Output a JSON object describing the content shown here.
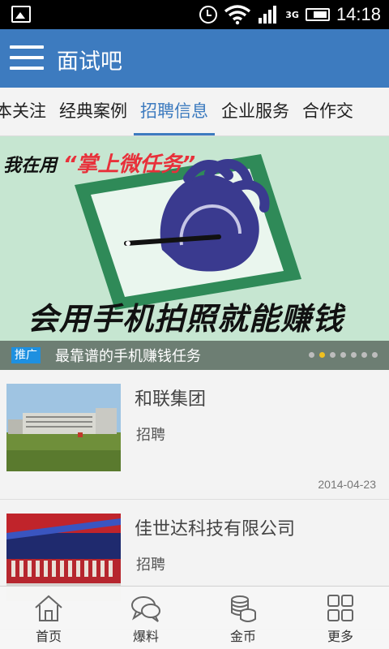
{
  "status_bar": {
    "network": "3G",
    "time": "14:18"
  },
  "app_bar": {
    "title": "面试吧"
  },
  "tabs": [
    {
      "label": "本关注",
      "active": false
    },
    {
      "label": "经典案例",
      "active": false
    },
    {
      "label": "招聘信息",
      "active": true
    },
    {
      "label": "企业服务",
      "active": false
    },
    {
      "label": "合作交",
      "active": false
    }
  ],
  "banner": {
    "head_prefix": "我在用",
    "head_quote": "“掌上微任务”",
    "slogan": "会用手机拍照就能赚钱",
    "tag": "推广",
    "caption": "最靠谱的手机赚钱任务",
    "slide_count": 7,
    "active_slide": 2
  },
  "list": [
    {
      "title": "和联集团",
      "type": "招聘",
      "date": "2014-04-23"
    },
    {
      "title": "佳世达科技有限公司",
      "type": "招聘",
      "date": ""
    }
  ],
  "bottom_nav": [
    {
      "label": "首页",
      "icon": "home-icon"
    },
    {
      "label": "爆料",
      "icon": "chat-bubbles-icon"
    },
    {
      "label": "金币",
      "icon": "coins-icon"
    },
    {
      "label": "更多",
      "icon": "grid-icon"
    }
  ],
  "colors": {
    "primary": "#3d7bbf",
    "tag_blue": "#1e90e0",
    "dot_active": "#f0c020",
    "quote_red": "#e8303a"
  }
}
